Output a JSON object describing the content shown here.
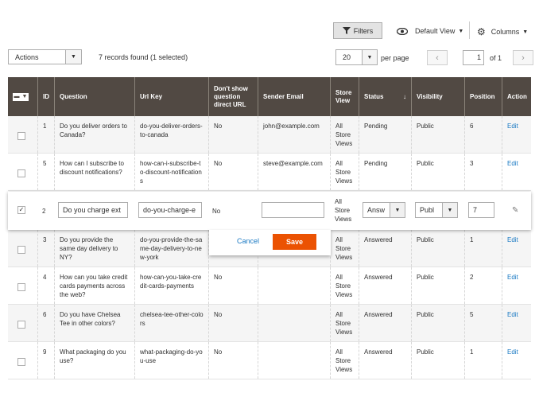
{
  "toolbar": {
    "filters_label": "Filters",
    "view_label": "Default View",
    "columns_label": "Columns"
  },
  "actions_select": {
    "value": "Actions"
  },
  "records_text": "7 records found (1 selected)",
  "pagination": {
    "per_page_value": "20",
    "per_page_label": "per page",
    "current_page": "1",
    "total_label": "of 1",
    "prev_glyph": "‹",
    "next_glyph": "›"
  },
  "columns": [
    "ID",
    "Question",
    "Url Key",
    "Don't show question direct URL",
    "Sender Email",
    "Store View",
    "Status",
    "Visibility",
    "Position",
    "Action"
  ],
  "sort_glyph": "↓",
  "rows": [
    {
      "id": "1",
      "question": "Do you deliver orders to Canada?",
      "url_key": "do-you-deliver-orders-to-canada",
      "direct_url": "No",
      "email": "john@example.com",
      "store": "All Store Views",
      "status": "Pending",
      "visibility": "Public",
      "position": "6",
      "action": "Edit"
    },
    {
      "id": "5",
      "question": "How can I subscribe to discount notifications?",
      "url_key": "how-can-i-subscribe-to-discount-notifications",
      "direct_url": "No",
      "email": "steve@example.com",
      "store": "All Store Views",
      "status": "Pending",
      "visibility": "Public",
      "position": "3",
      "action": "Edit"
    },
    {
      "id": "3",
      "question": "Do you provide the same day delivery to NY?",
      "url_key": "do-you-provide-the-same-day-delivery-to-new-york",
      "direct_url": "No",
      "email": "",
      "store": "All Store Views",
      "status": "Answered",
      "visibility": "Public",
      "position": "1",
      "action": "Edit"
    },
    {
      "id": "4",
      "question": "How can you take credit cards payments across the web?",
      "url_key": "how-can-you-take-credit-cards-payments",
      "direct_url": "No",
      "email": "",
      "store": "All Store Views",
      "status": "Answered",
      "visibility": "Public",
      "position": "2",
      "action": "Edit"
    },
    {
      "id": "6",
      "question": "Do you have Chelsea Tee in other colors?",
      "url_key": "chelsea-tee-other-colors",
      "direct_url": "No",
      "email": "",
      "store": "All Store Views",
      "status": "Answered",
      "visibility": "Public",
      "position": "5",
      "action": "Edit"
    },
    {
      "id": "9",
      "question": "What packaging do you use?",
      "url_key": "what-packaging-do-you-use",
      "direct_url": "No",
      "email": "",
      "store": "All Store Views",
      "status": "Answered",
      "visibility": "Public",
      "position": "1",
      "action": "Edit"
    }
  ],
  "edit_row": {
    "id": "2",
    "question_value": "Do you charge ext",
    "url_key_value": "do-you-charge-e",
    "direct_url": "No",
    "email_value": "",
    "store": "All Store Views",
    "status_value": "Answ",
    "visibility_value": "Publ",
    "position_value": "7",
    "cancel_label": "Cancel",
    "save_label": "Save"
  },
  "colors": {
    "header_bg": "#514943",
    "accent": "#eb5202",
    "link": "#1979c3"
  }
}
